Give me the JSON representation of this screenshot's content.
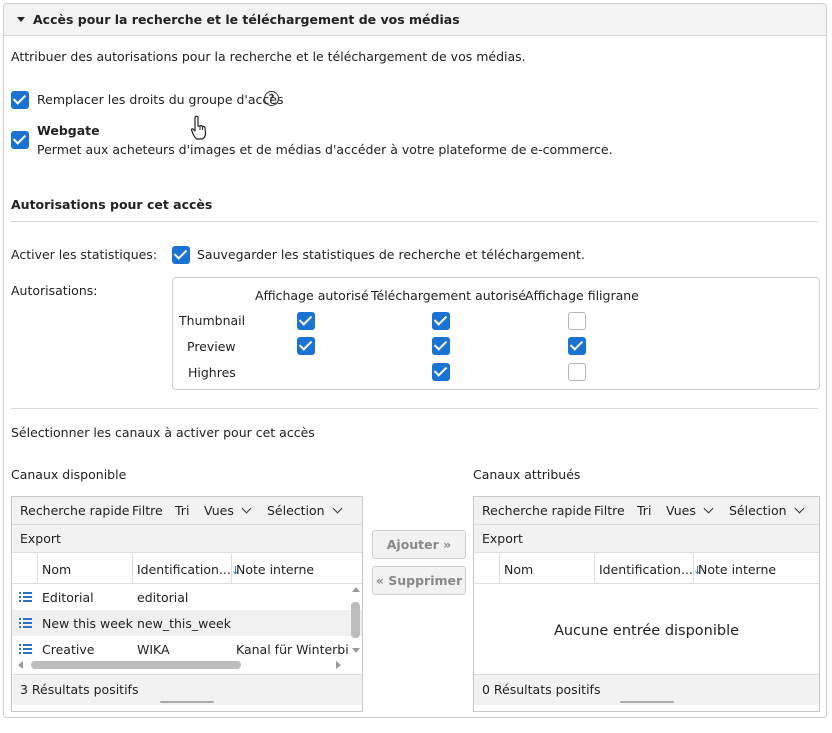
{
  "panel": {
    "title": "Accès pour la recherche et le téléchargement de vos médias",
    "description": "Attribuer des autorisations pour la recherche et le téléchargement de vos médias."
  },
  "options": {
    "replace_rights_label": "Remplacer les droits du groupe d'accès",
    "replace_rights_checked": true,
    "help_glyph": "?",
    "webgate_title": "Webgate",
    "webgate_desc": "Permet aux acheteurs d'images et de médias d'accéder à votre plateforme de e-commerce.",
    "webgate_checked": true
  },
  "permissions_section": {
    "heading": "Autorisations pour cet accès",
    "stats_label": "Activer les statistiques:",
    "stats_checkbox_label": "Sauvegarder les statistiques de recherche et téléchargement.",
    "stats_checked": true,
    "auth_label": "Autorisations:",
    "columns": [
      "Affichage autorisé",
      "Téléchargement autorisé",
      "Affichage filigrane"
    ],
    "rows": [
      {
        "name": "Thumbnail",
        "display": true,
        "download": true,
        "watermark": false
      },
      {
        "name": "Preview",
        "display": true,
        "download": true,
        "watermark": true
      },
      {
        "name": "Highres",
        "display": null,
        "download": true,
        "watermark": false
      }
    ]
  },
  "channels_section": {
    "heading": "Sélectionner les canaux à activer pour cet accès",
    "available_title": "Canaux disponible",
    "assigned_title": "Canaux attribués",
    "toolbar": {
      "quick_search": "Recherche rapide",
      "filter": "Filtre",
      "sort": "Tri",
      "views": "Vues",
      "selection": "Sélection",
      "export": "Export"
    },
    "columns": {
      "name": "Nom",
      "identification": "Identification...",
      "note": "Note interne",
      "sort_glyph": "↓"
    },
    "available_rows": [
      {
        "name": "Editorial",
        "id": "editorial",
        "note": ""
      },
      {
        "name": "New this week",
        "id": "new_this_week",
        "note": ""
      },
      {
        "name": "Creative",
        "id": "WIKA",
        "note": "Kanal für Winterbilder"
      }
    ],
    "available_count": "3 Résultats positifs",
    "assigned_empty": "Aucune entrée disponible",
    "assigned_count": "0 Résultats positifs",
    "add_button": "Ajouter",
    "remove_button": "Supprimer"
  }
}
